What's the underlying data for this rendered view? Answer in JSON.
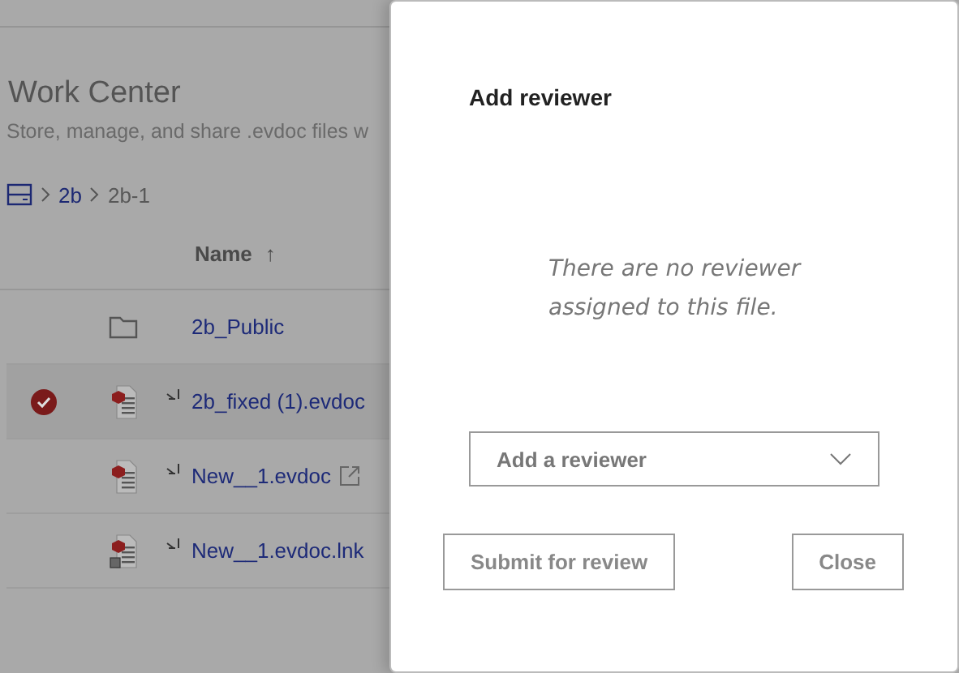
{
  "page": {
    "title": "Work Center",
    "subtitle": "Store, manage, and share .evdoc files w",
    "breadcrumb": [
      "2b",
      "2b-1"
    ],
    "column": "Name",
    "sort_arrow": "↑"
  },
  "rows": [
    {
      "name": "2b_Public",
      "kind": "folder",
      "selected": false,
      "synced": false,
      "external": false
    },
    {
      "name": "2b_fixed (1).evdoc",
      "kind": "evdoc",
      "selected": true,
      "synced": true,
      "external": false
    },
    {
      "name": "New__1.evdoc",
      "kind": "evdoc",
      "selected": false,
      "synced": true,
      "external": true
    },
    {
      "name": "New__1.evdoc.lnk",
      "kind": "shortcut",
      "selected": false,
      "synced": true,
      "external": false
    }
  ],
  "dialog": {
    "title": "Add reviewer",
    "message": "There are no reviewer assigned to this file.",
    "select": {
      "placeholder": "Add a reviewer"
    },
    "buttons": [
      "Submit for review",
      "Close"
    ]
  }
}
